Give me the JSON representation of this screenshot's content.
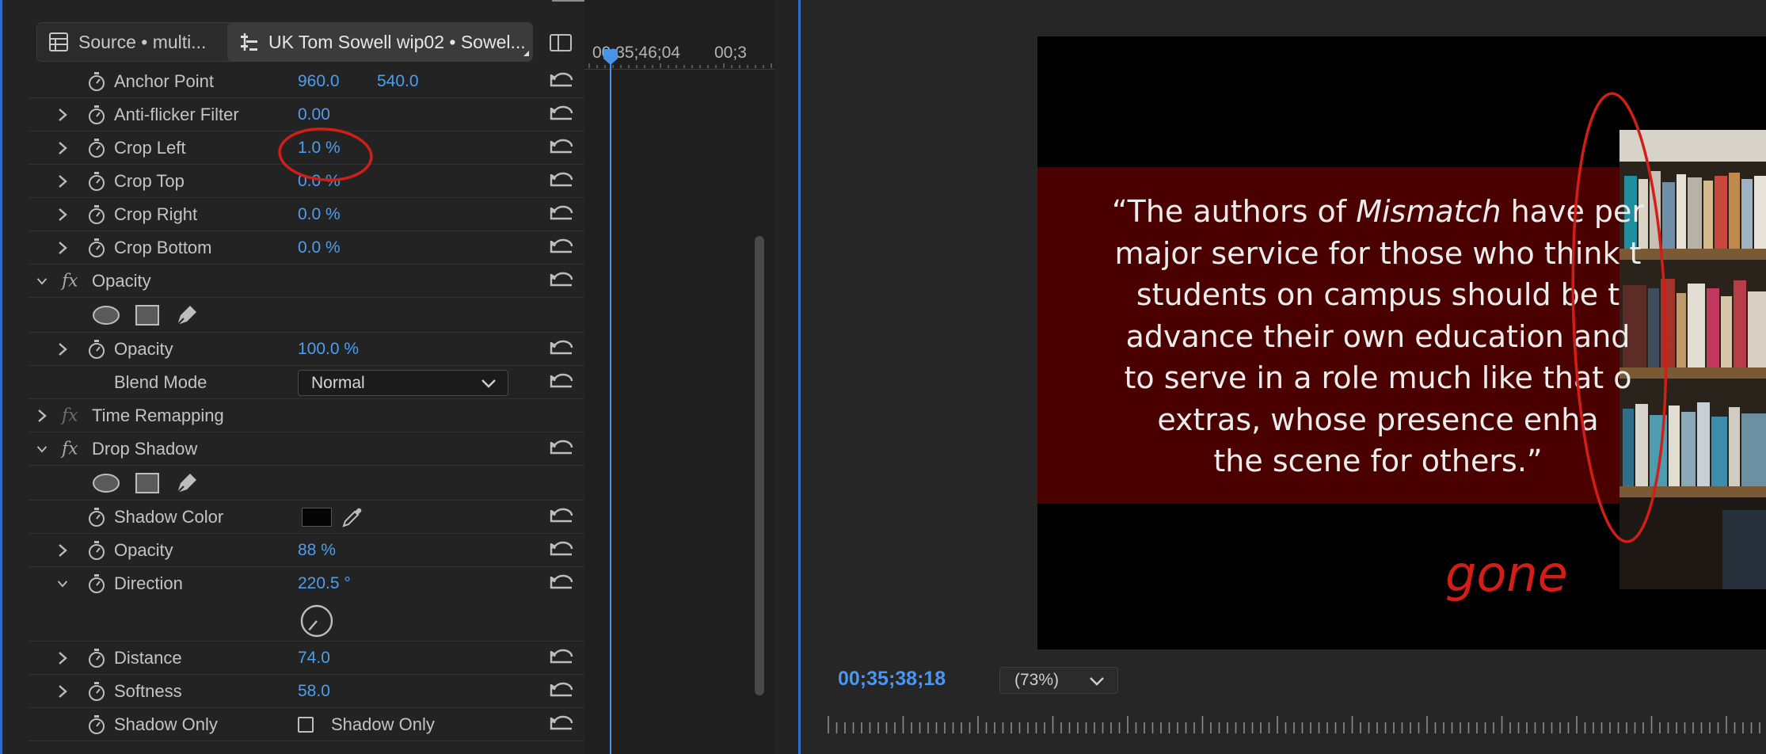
{
  "tabs": {
    "source": "Source • multi...",
    "sequence": "UK Tom Sowell  wip02 • Sowel..."
  },
  "timeline": {
    "time_a": "00;35;46;04",
    "time_b": "00;3"
  },
  "properties": {
    "anchor_point": {
      "label": "Anchor Point",
      "x": "960.0",
      "y": "540.0"
    },
    "anti_flicker": {
      "label": "Anti-flicker Filter",
      "value": "0.00"
    },
    "crop_left": {
      "label": "Crop Left",
      "value": "1.0 %"
    },
    "crop_top": {
      "label": "Crop Top",
      "value": "0.0 %"
    },
    "crop_right": {
      "label": "Crop Right",
      "value": "0.0 %"
    },
    "crop_bottom": {
      "label": "Crop Bottom",
      "value": "0.0 %"
    },
    "opacity_section": "Opacity",
    "opacity": {
      "label": "Opacity",
      "value": "100.0 %"
    },
    "blend_mode": {
      "label": "Blend Mode",
      "value": "Normal"
    },
    "time_remapping": "Time Remapping",
    "drop_shadow": "Drop Shadow",
    "shadow_color": {
      "label": "Shadow Color",
      "color": "#050505"
    },
    "shadow_opacity": {
      "label": "Opacity",
      "value": "88 %"
    },
    "direction": {
      "label": "Direction",
      "value": "220.5 °",
      "angle_deg": 220.5
    },
    "distance": {
      "label": "Distance",
      "value": "74.0"
    },
    "softness": {
      "label": "Softness",
      "value": "58.0"
    },
    "shadow_only": {
      "label": "Shadow Only",
      "checkbox_label": "Shadow Only",
      "checked": false
    }
  },
  "monitor": {
    "quote_lines": [
      [
        "“The authors of ",
        "Mismatch",
        " have per"
      ],
      [
        "major service for those who think t"
      ],
      [
        "students on campus should be t"
      ],
      [
        "advance their own education and"
      ],
      [
        "to serve in a role much like that o"
      ],
      [
        "extras, whose presence enha"
      ],
      [
        "the scene for others.”"
      ]
    ],
    "annotation_text": "gone",
    "timecode": "00;35;38;18",
    "zoom": "(73%)"
  },
  "icons": {
    "stopwatch": "stopwatch-icon",
    "reset": "reset-icon",
    "fx": "fx-badge-icon",
    "ellipse": "ellipse-mask-icon",
    "rectangle": "rectangle-mask-icon",
    "pen": "pen-mask-icon",
    "eyedropper": "eyedropper-icon",
    "dial": "angle-dial-icon",
    "source": "multicam-icon",
    "sequence": "sequence-icon"
  },
  "colors": {
    "value_blue": "#4b9ff0",
    "accent_border": "#2f6fc9",
    "annotation_red": "#d21e17",
    "title_band": "#4b0000"
  }
}
